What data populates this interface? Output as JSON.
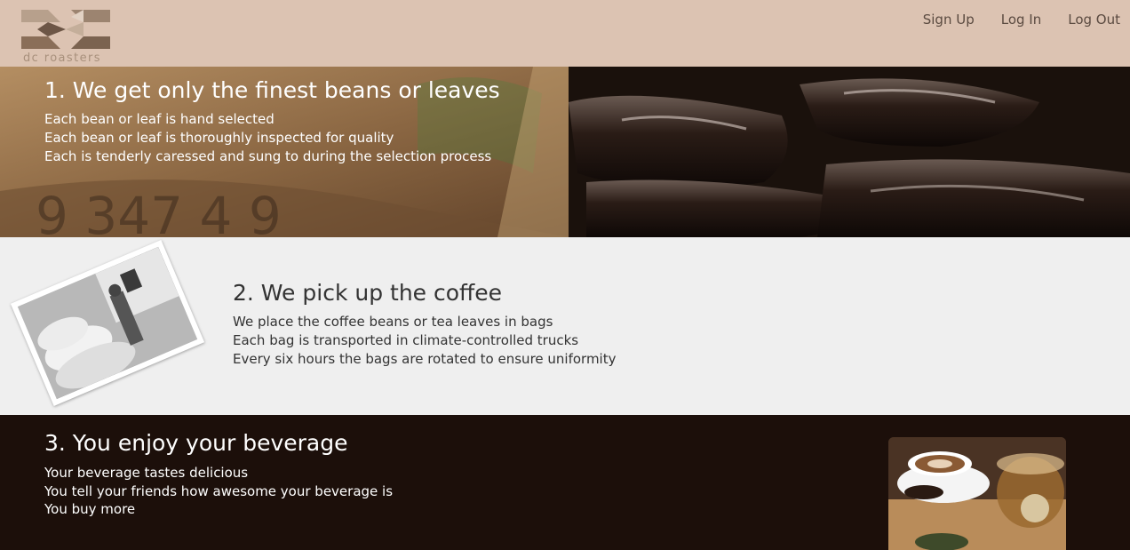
{
  "header": {
    "logo_text": "dc roasters",
    "nav": [
      {
        "label": "Sign Up"
      },
      {
        "label": "Log In"
      },
      {
        "label": "Log Out"
      }
    ]
  },
  "sections": [
    {
      "title": "1. We get only the finest beans or leaves",
      "lines": [
        "Each bean or leaf is hand selected",
        "Each bean or leaf is thoroughly inspected for quality",
        "Each is tenderly caressed and sung to during the selection process"
      ],
      "image_alt": "coffee-sacks-photo",
      "sack_numbers": "9 347 4 9"
    },
    {
      "title": "2. We pick up the coffee",
      "lines": [
        "We place the coffee beans or tea leaves in bags",
        "Each bag is transported in climate-controlled trucks",
        "Every six hours the bags are rotated to ensure uniformity"
      ],
      "image_alt": "worker-with-bags-photo"
    },
    {
      "title": "3. You enjoy your beverage",
      "lines": [
        "Your beverage tastes delicious",
        "You tell your friends how awesome your beverage is",
        "You buy more"
      ],
      "image_alt": "coffee-and-tea-cups-photo"
    }
  ],
  "colors": {
    "header_bg": "#dcc3b2",
    "section2_bg": "#efefef",
    "section3_bg": "#1c0f0a",
    "nav_text": "#5a4a40"
  }
}
